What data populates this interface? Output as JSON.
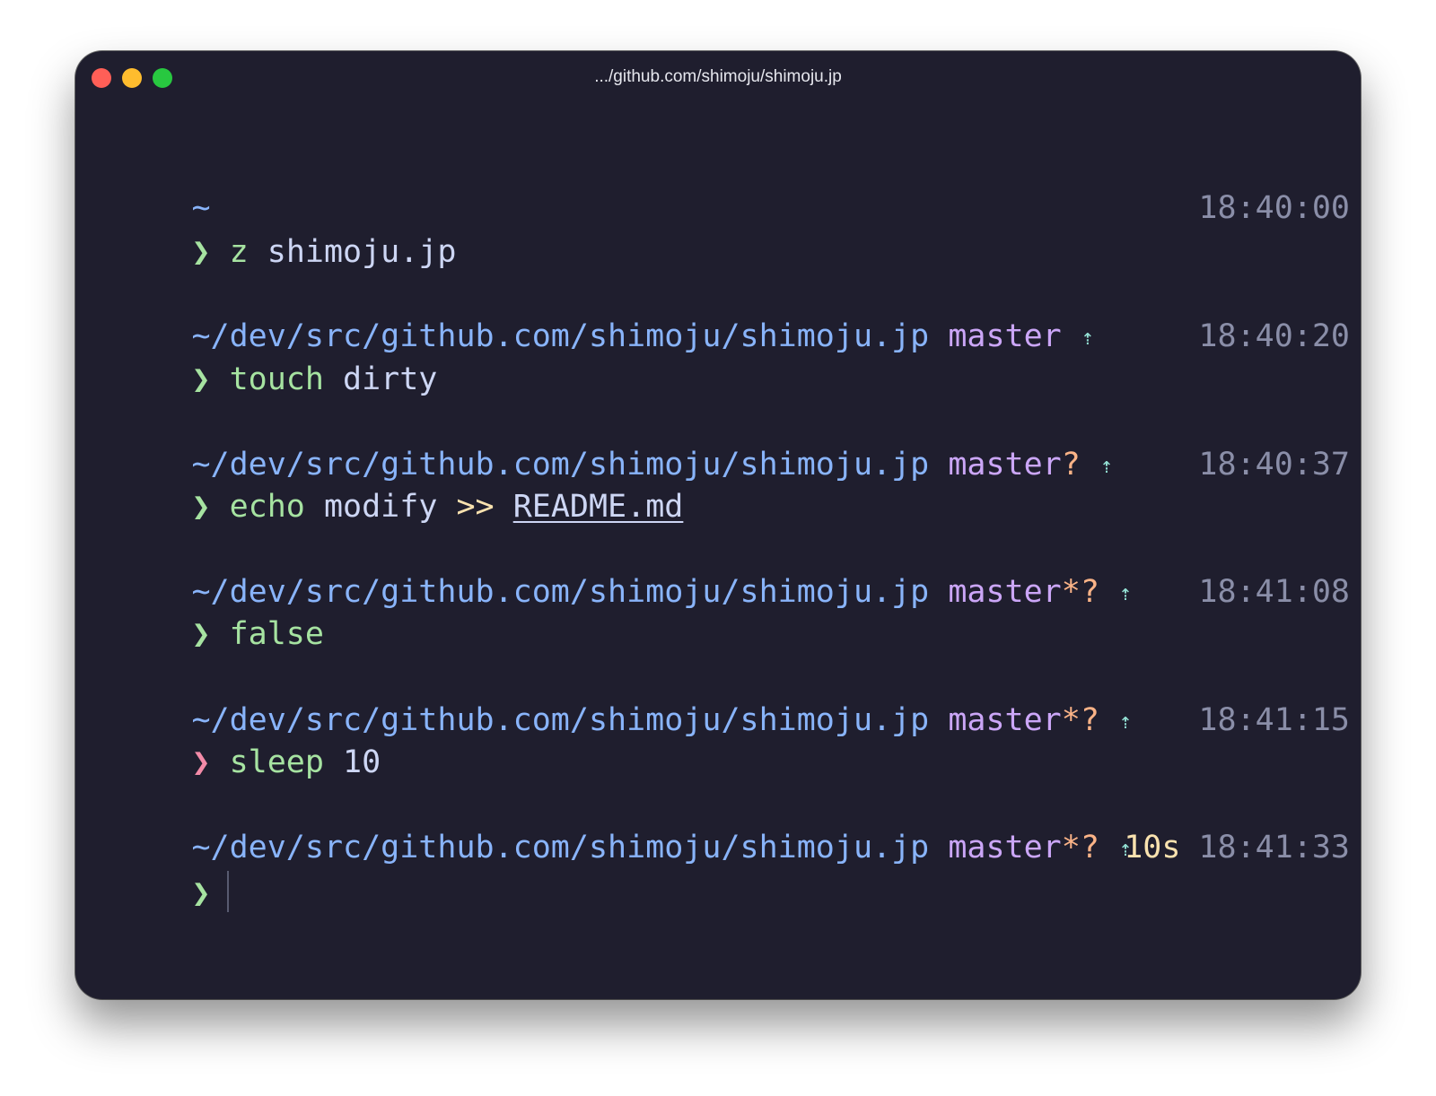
{
  "window": {
    "title": ".../github.com/shimoju/shimoju.jp"
  },
  "blocks": [
    {
      "path": "~",
      "branch": "",
      "dirty": "",
      "arrow": "",
      "duration": "",
      "time": "18:40:00",
      "prompt": "❯",
      "prompt_status": "ok",
      "command": "z",
      "args": " shimoju.jp"
    },
    {
      "path": "~/dev/src/github.com/shimoju/shimoju.jp",
      "branch": "master",
      "dirty": "",
      "arrow": "⇡",
      "duration": "",
      "time": "18:40:20",
      "prompt": "❯",
      "prompt_status": "ok",
      "command": "touch",
      "args": " dirty"
    },
    {
      "path": "~/dev/src/github.com/shimoju/shimoju.jp",
      "branch": "master",
      "dirty": "?",
      "arrow": "⇡",
      "duration": "",
      "time": "18:40:37",
      "prompt": "❯",
      "prompt_status": "ok",
      "command": "echo",
      "args": " modify ",
      "operator": ">>",
      "file": "README.md"
    },
    {
      "path": "~/dev/src/github.com/shimoju/shimoju.jp",
      "branch": "master",
      "dirty": "*?",
      "arrow": "⇡",
      "duration": "",
      "time": "18:41:08",
      "prompt": "❯",
      "prompt_status": "ok",
      "command": "false",
      "args": ""
    },
    {
      "path": "~/dev/src/github.com/shimoju/shimoju.jp",
      "branch": "master",
      "dirty": "*?",
      "arrow": "⇡",
      "duration": "",
      "time": "18:41:15",
      "prompt": "❯",
      "prompt_status": "error",
      "command": "sleep",
      "args": " 10"
    },
    {
      "path": "~/dev/src/github.com/shimoju/shimoju.jp",
      "branch": "master",
      "dirty": "*?",
      "arrow": "⇡",
      "duration": "10s",
      "time": "18:41:33",
      "prompt": "❯",
      "prompt_status": "ok",
      "command": "",
      "args": ""
    }
  ],
  "colors": {
    "background": "#1f1e2e",
    "path": "#89b4fa",
    "branch": "#cba6f7",
    "dirty": "#fab387",
    "arrow": "#94e2d5",
    "time": "#8a8ea8",
    "duration": "#f9e2af",
    "prompt_ok": "#a6e3a1",
    "prompt_error": "#f38ba8"
  }
}
